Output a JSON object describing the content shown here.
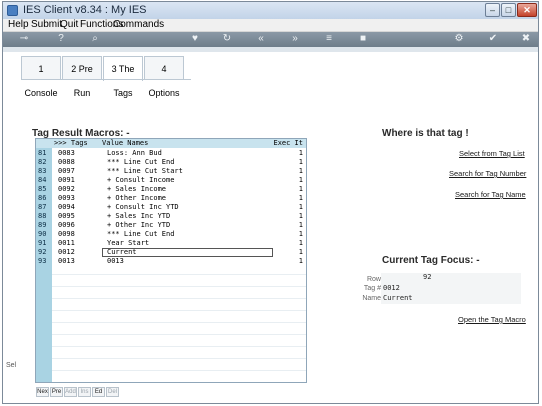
{
  "window": {
    "title": "IES Client v8.34 : My IES"
  },
  "window_controls": {
    "minimize": "–",
    "maximize": "□",
    "close": "✕"
  },
  "menu": [
    "Help",
    "Submit",
    "Quit",
    "Functions",
    "Commands"
  ],
  "tabs": [
    {
      "label": "1 Console",
      "active": false
    },
    {
      "label": "2 Pre Run",
      "active": false
    },
    {
      "label": "3 The Tags",
      "active": true
    },
    {
      "label": "4 Options",
      "active": false
    }
  ],
  "grid": {
    "title": "Tag Result Macros: -",
    "headers": {
      "tags": ">>> Tags",
      "names": "Value Names",
      "exec": "Exec It"
    },
    "rows": [
      {
        "n": "81",
        "tag": "0083",
        "name": "Loss: Ann Bud",
        "exec": "1"
      },
      {
        "n": "82",
        "tag": "0088",
        "name": "*** Line Cut End",
        "exec": "1"
      },
      {
        "n": "83",
        "tag": "0097",
        "name": "*** Line Cut Start",
        "exec": "1"
      },
      {
        "n": "84",
        "tag": "0091",
        "name": "+ Consult Income",
        "exec": "1"
      },
      {
        "n": "85",
        "tag": "0092",
        "name": "+ Sales Income",
        "exec": "1"
      },
      {
        "n": "86",
        "tag": "0093",
        "name": "+ Other Income",
        "exec": "1"
      },
      {
        "n": "87",
        "tag": "0094",
        "name": "+ Consult Inc YTD",
        "exec": "1"
      },
      {
        "n": "88",
        "tag": "0095",
        "name": "+ Sales Inc YTD",
        "exec": "1"
      },
      {
        "n": "89",
        "tag": "0096",
        "name": "+ Other Inc YTD",
        "exec": "1"
      },
      {
        "n": "90",
        "tag": "0098",
        "name": "*** Line Cut End",
        "exec": "1"
      },
      {
        "n": "91",
        "tag": "0011",
        "name": "Year Start",
        "exec": "1"
      },
      {
        "n": "92",
        "tag": "0012",
        "name": "Current",
        "exec": "1"
      },
      {
        "n": "93",
        "tag": "0013",
        "name": "0013",
        "exec": "1"
      }
    ]
  },
  "bottom_buttons": [
    {
      "label": "Nex",
      "enabled": true
    },
    {
      "label": "Pre",
      "enabled": true
    },
    {
      "label": "Add",
      "enabled": false
    },
    {
      "label": "Ins",
      "enabled": false
    },
    {
      "label": "Ed",
      "enabled": true
    },
    {
      "label": "Del",
      "enabled": false
    }
  ],
  "side_stub": "Sel",
  "where": {
    "title": "Where is that tag !",
    "links": [
      "Select from Tag List",
      "Search for Tag Number",
      "Search for Tag Name"
    ]
  },
  "focus": {
    "title": "Current Tag Focus: -",
    "row_label": "Row",
    "row_value": "92",
    "tag_label": "Tag #",
    "tag_value": "0012",
    "name_label": "Name",
    "name_value": "Current",
    "open_link": "Open the Tag Macro"
  },
  "toolbar_icons": [
    "key-icon",
    "help-icon",
    "search-icon",
    "heart-icon",
    "refresh-icon",
    "rewind-icon",
    "fast-forward-icon",
    "list-icon",
    "stop-icon",
    "settings-icon",
    "ok-icon",
    "close-icon"
  ],
  "colors": {
    "toolbar": "#7d8b98",
    "grid_header": "#c8e3ee",
    "row_numbers": "#a9d3e3"
  }
}
